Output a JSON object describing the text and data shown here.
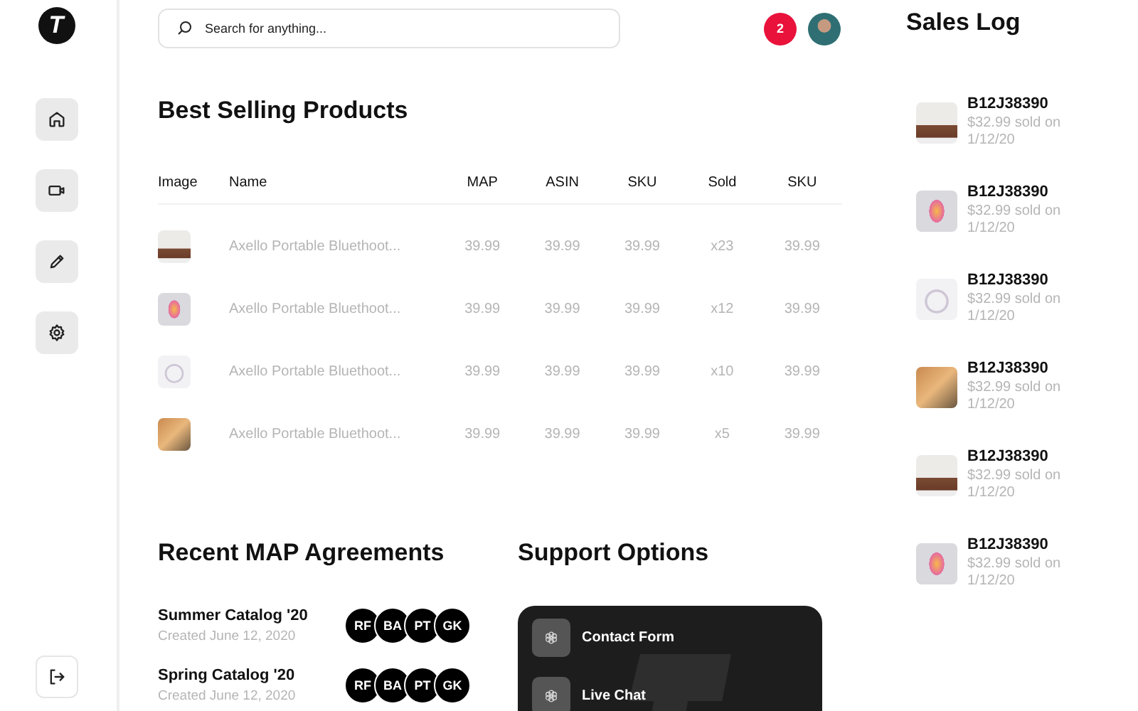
{
  "sidebar": {
    "logo": "T",
    "items": [
      {
        "kind": "home"
      },
      {
        "kind": "video"
      },
      {
        "kind": "pencil"
      },
      {
        "kind": "settings"
      }
    ],
    "logout": {
      "kind": "logout"
    }
  },
  "search": {
    "placeholder": "Search for anything..."
  },
  "header": {
    "notifications": "2"
  },
  "products": {
    "title": "Best Selling Products",
    "columns": [
      "Image",
      "Name",
      "MAP",
      "ASIN",
      "SKU",
      "Sold",
      "SKU"
    ],
    "rows": [
      {
        "kind": "sofa",
        "name": "Axello Portable Bluethoot...",
        "map": "39.99",
        "asin": "39.99",
        "sku": "39.99",
        "sold": "x23",
        "sku_2": "39.99"
      },
      {
        "kind": "phone",
        "name": "Axello Portable Bluethoot...",
        "map": "39.99",
        "asin": "39.99",
        "sku": "39.99",
        "sold": "x12",
        "sku_2": "39.99"
      },
      {
        "kind": "headphones",
        "name": "Axello Portable Bluethoot...",
        "map": "39.99",
        "asin": "39.99",
        "sku": "39.99",
        "sold": "x10",
        "sku_2": "39.99"
      },
      {
        "kind": "wood",
        "name": "Axello Portable Bluethoot...",
        "map": "39.99",
        "asin": "39.99",
        "sku": "39.99",
        "sold": "x5",
        "sku_2": "39.99"
      }
    ]
  },
  "agreements": {
    "title": "Recent MAP Agreements",
    "items": [
      {
        "name": "Summer Catalog '20",
        "created": "Created June 12, 2020",
        "members": [
          "RF",
          "BA",
          "PT",
          "GK"
        ]
      },
      {
        "name": "Spring Catalog '20",
        "created": "Created June 12, 2020",
        "members": [
          "RF",
          "BA",
          "PT",
          "GK"
        ]
      }
    ]
  },
  "support": {
    "title": "Support Options",
    "items": [
      {
        "label": "Contact Form"
      },
      {
        "label": "Live Chat"
      }
    ]
  },
  "sales_log": {
    "title": "Sales Log",
    "items": [
      {
        "kind": "sofa",
        "sku": "B12J38390",
        "detail": "$32.99 sold on 1/12/20"
      },
      {
        "kind": "phone",
        "sku": "B12J38390",
        "detail": "$32.99 sold on 1/12/20"
      },
      {
        "kind": "headphones",
        "sku": "B12J38390",
        "detail": "$32.99 sold on 1/12/20"
      },
      {
        "kind": "wood",
        "sku": "B12J38390",
        "detail": "$32.99 sold on 1/12/20"
      },
      {
        "kind": "sofa",
        "sku": "B12J38390",
        "detail": "$32.99 sold on 1/12/20"
      },
      {
        "kind": "phone",
        "sku": "B12J38390",
        "detail": "$32.99 sold on 1/12/20"
      }
    ]
  }
}
